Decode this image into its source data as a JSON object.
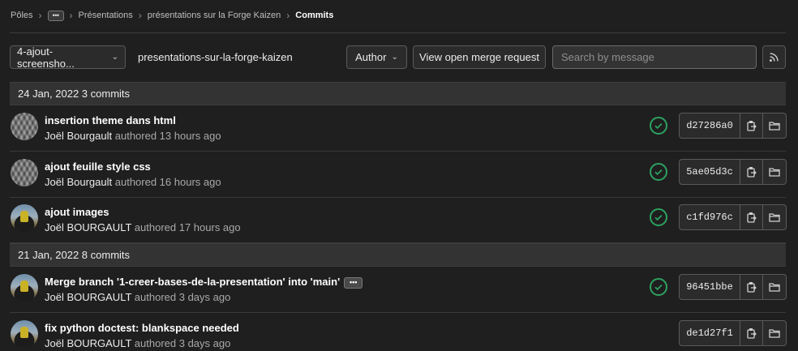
{
  "breadcrumb": {
    "items": [
      "Pôles",
      "Présentations",
      "présentations sur la Forge Kaizen"
    ],
    "current": "Commits",
    "more_label": "•••"
  },
  "toolbar": {
    "branch": "4-ajout-screensho...",
    "project": "presentations-sur-la-forge-kaizen",
    "author_label": "Author",
    "mr_label": "View open merge request",
    "search_placeholder": "Search by message"
  },
  "days": [
    {
      "header": "24 Jan, 2022 3 commits",
      "commits": [
        {
          "title": "insertion theme dans html",
          "author": "Joël Bourgault",
          "authored": "authored 13 hours ago",
          "sha": "d27286a0",
          "status": "success",
          "avatar": "knit"
        },
        {
          "title": "ajout feuille style css",
          "author": "Joël Bourgault",
          "authored": "authored 16 hours ago",
          "sha": "5ae05d3c",
          "status": "success",
          "avatar": "knit"
        },
        {
          "title": "ajout images",
          "author": "Joël BOURGAULT",
          "authored": "authored 17 hours ago",
          "sha": "c1fd976c",
          "status": "success",
          "avatar": "moto"
        }
      ]
    },
    {
      "header": "21 Jan, 2022 8 commits",
      "commits": [
        {
          "title": "Merge branch '1-creer-bases-de-la-presentation' into 'main'",
          "author": "Joël BOURGAULT",
          "authored": "authored 3 days ago",
          "sha": "96451bbe",
          "status": "success",
          "avatar": "moto",
          "ellipsis": "•••"
        },
        {
          "title": "fix python doctest: blankspace needed",
          "author": "Joël BOURGAULT",
          "authored": "authored 3 days ago",
          "sha": "de1d27f1",
          "status": "none",
          "avatar": "moto"
        }
      ]
    }
  ],
  "colors": {
    "background": "#1f1f1f",
    "success": "#2da160",
    "header_bg": "#333333"
  }
}
